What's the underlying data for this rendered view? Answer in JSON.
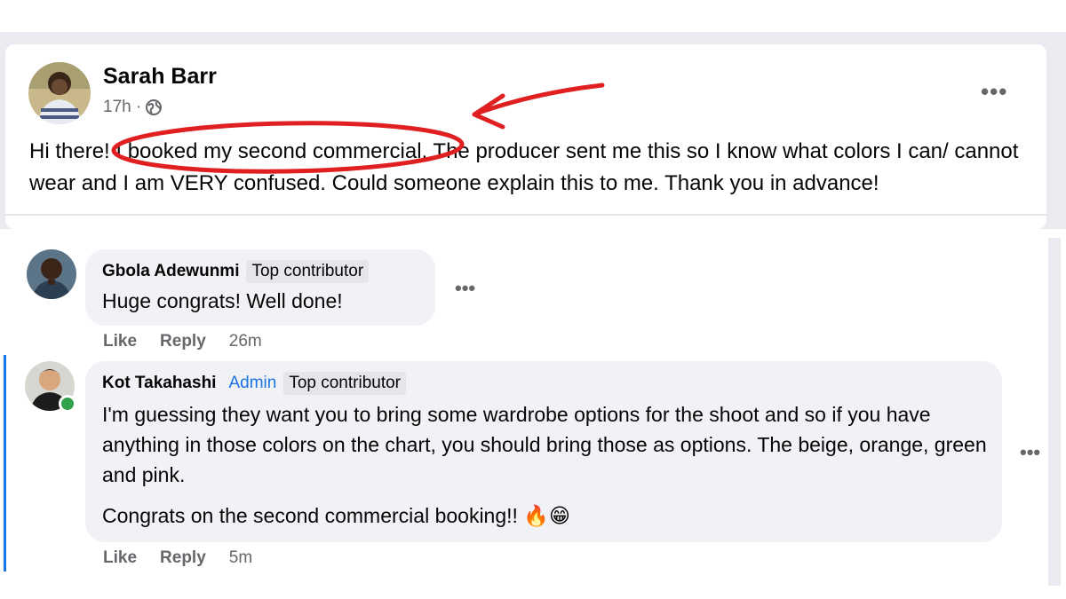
{
  "post": {
    "author": "Sarah Barr",
    "time": "17h ·",
    "text_before": "Hi there! ",
    "text_highlight": "I booked my second commercial.",
    "text_after": " The producer sent me this so I know what colors I can/ cannot wear and I am VERY confused. Could someone explain this to me. Thank you in advance!",
    "more_icon": "more-horizontal-icon",
    "privacy_icon": "globe-icon",
    "annotation_color": "#e02020"
  },
  "comments": [
    {
      "author": "Gbola Adewunmi",
      "badges": [
        "Top contributor"
      ],
      "text": "Huge congrats! Well done!",
      "like": "Like",
      "reply": "Reply",
      "time": "26m"
    },
    {
      "author": "Kot Takahashi",
      "role": "Admin",
      "badges": [
        "Top contributor"
      ],
      "text": "I'm guessing they want you to bring some wardrobe options for the shoot and so if you have anything in those colors on the chart, you should bring those as options. The beige, orange, green and pink.",
      "text2": "Congrats on the second commercial booking!! 🔥😁",
      "like": "Like",
      "reply": "Reply",
      "time": "5m",
      "online": true
    }
  ],
  "colors": {
    "accent": "#1b74e4",
    "online": "#31a24c",
    "bubble": "#f0f2f5"
  }
}
